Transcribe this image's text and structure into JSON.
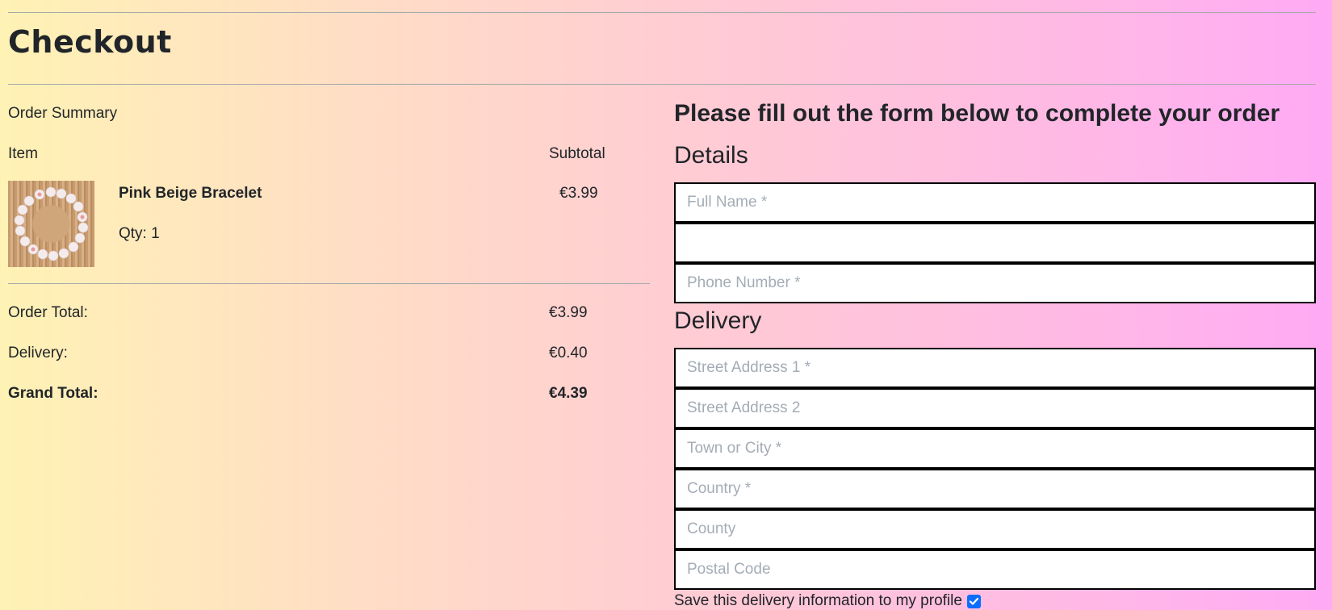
{
  "page": {
    "title": "Checkout"
  },
  "summary": {
    "label": "Order Summary",
    "columns": {
      "item": "Item",
      "subtotal": "Subtotal"
    },
    "items": [
      {
        "name": "Pink Beige Bracelet",
        "qty": "Qty: 1",
        "price": "€3.99"
      }
    ],
    "totals": {
      "order_label": "Order Total:",
      "order_value": "€3.99",
      "delivery_label": "Delivery:",
      "delivery_value": "€0.40",
      "grand_label": "Grand Total:",
      "grand_value": "€4.39"
    }
  },
  "form": {
    "heading": "Please fill out the form below to complete your order",
    "details_title": "Details",
    "delivery_title": "Delivery",
    "fields": {
      "full_name": {
        "placeholder": "Full Name *",
        "value": ""
      },
      "email": {
        "placeholder": "",
        "value": ""
      },
      "phone": {
        "placeholder": "Phone Number *",
        "value": ""
      },
      "street1": {
        "placeholder": "Street Address 1 *",
        "value": ""
      },
      "street2": {
        "placeholder": "Street Address 2",
        "value": ""
      },
      "town": {
        "placeholder": "Town or City *",
        "value": ""
      },
      "country": {
        "placeholder": "Country *",
        "value": ""
      },
      "county": {
        "placeholder": "County",
        "value": ""
      },
      "postcode": {
        "placeholder": "Postal Code",
        "value": ""
      }
    },
    "save_label": "Save this delivery information to my profile",
    "save_checked": true
  },
  "colors": {
    "checkbox": "#0d6efd",
    "placeholder": "#a4acb6"
  }
}
